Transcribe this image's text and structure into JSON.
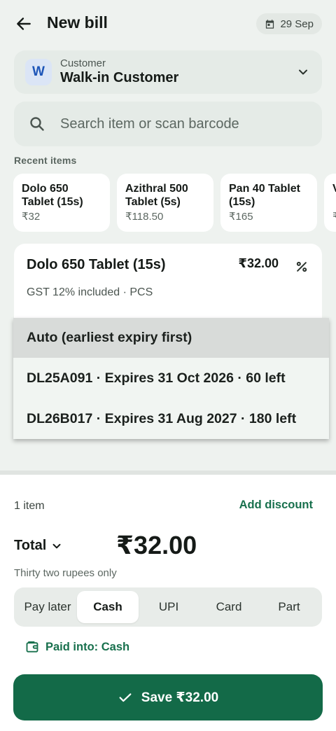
{
  "header": {
    "title": "New bill",
    "date": "29 Sep"
  },
  "customer": {
    "avatar_letter": "W",
    "label": "Customer",
    "name": "Walk-in Customer"
  },
  "search": {
    "placeholder": "Search item or scan barcode"
  },
  "recent": {
    "title": "Recent items",
    "items": [
      {
        "name": "Dolo 650 Tablet (15s)",
        "price": "₹32"
      },
      {
        "name": "Azithral 500 Tablet (5s)",
        "price": "₹118.50"
      },
      {
        "name": "Pan 40 Tablet (15s)",
        "price": "₹165"
      },
      {
        "name": "V g",
        "price": "₹"
      }
    ]
  },
  "item": {
    "name": "Dolo 650 Tablet (15s)",
    "price": "₹32.00",
    "meta": "GST 12% included · PCS"
  },
  "batch_dropdown": {
    "options": [
      "Auto (earliest expiry first)",
      "DL25A091 · Expires 31 Oct 2026 · 60 left",
      "DL26B017 · Expires 31 Aug 2027 · 180 left"
    ],
    "selected_index": 0
  },
  "summary": {
    "count": "1 item",
    "add_discount": "Add discount",
    "total_label": "Total",
    "total_value": "₹32.00",
    "words": "Thirty two rupees only"
  },
  "payment": {
    "tabs": [
      "Pay later",
      "Cash",
      "UPI",
      "Card",
      "Part"
    ],
    "active_index": 1,
    "paid_into": "Paid into: Cash"
  },
  "save": {
    "label": "Save ₹32.00"
  },
  "colors": {
    "brand_green": "#136a48",
    "link_green": "#18704d",
    "avatar_blue": "#1e56b8"
  }
}
